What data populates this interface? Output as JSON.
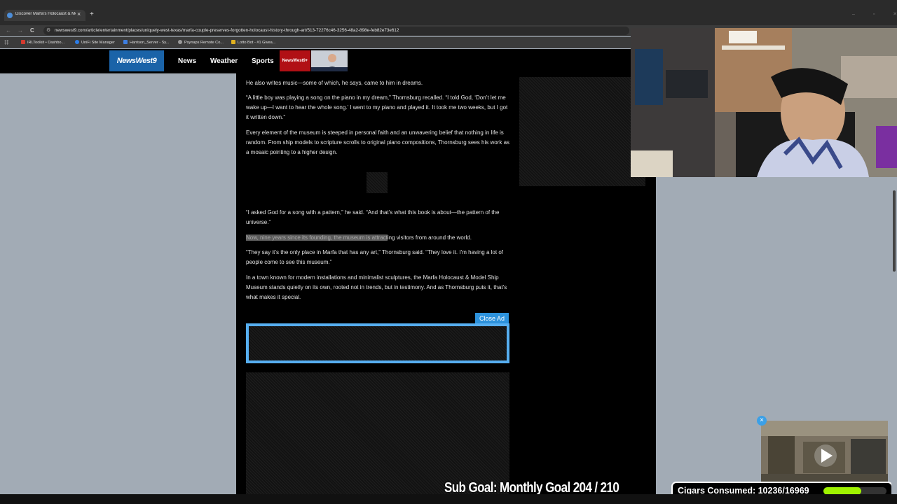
{
  "browser": {
    "tab_title": "Discover Marfa's Holocaust & Model Ship Museum",
    "tab_close": "×",
    "new_tab": "+",
    "url": "newswest9.com/article/entertainment/places/uniquely-west-texas/marfa-couple-preserves-forgotten-holocaust-history-through-art/513-72276c46-3256-48a2-898e-feb82e73e612",
    "window_controls": "– ▫ ✕",
    "nav_back": "←",
    "nav_forward": "→",
    "nav_reload": "C",
    "bookmarks": [
      {
        "label": "IRLToolkit • Dashbo...",
        "color": "#d43a2f"
      },
      {
        "label": "UniFi Site Manager",
        "color": "#2b7de9"
      },
      {
        "label": "Harrison_Server - Sy...",
        "color": "#3d7ee0"
      },
      {
        "label": "Psynaps Remote Co...",
        "color": "#9a9a9a"
      },
      {
        "label": "Lotto Bot - #1 Givea...",
        "color": "#e0b020"
      }
    ]
  },
  "site": {
    "logo": "NewsWest9",
    "nav": [
      "News",
      "Weather",
      "Sports"
    ],
    "plus_badge": "NewsWest9+"
  },
  "article": {
    "paragraphs": [
      "He also writes music—some of which, he says, came to him in dreams.",
      "“A little boy was playing a song on the piano in my dream,” Thornsburg recalled. “I told God, ‘Don’t let me wake up—I want to hear the whole song.’ I went to my piano and played it. It took me two weeks, but I got it written down.”",
      "Every element of the museum is steeped in personal faith and an unwavering belief that nothing in life is random. From ship models to scripture scrolls to original piano compositions, Thornsburg sees his work as a mosaic pointing to a higher design.",
      "“I asked God for a song with a pattern,” he said. “And that’s what this book is about—the pattern of the universe.”",
      "“They say it’s the only place in Marfa that has any art,” Thornsburg said. “They love it. I’m having a lot of people come to see this museum.”",
      "In a town known for modern installations and minimalist sculptures, the Marfa Holocaust & Model Ship Museum stands quietly on its own, rooted not in trends, but in testimony. And as Thornsburg puts it, that’s what makes it special."
    ],
    "highlight_selected": "Now, nine years since its founding, the museum is attract",
    "highlight_rest": "ing visitors from around the world.",
    "close_ad": "Close Ad"
  },
  "overlay": {
    "subgoal": "Sub Goal: Monthly Goal  204 / 210",
    "cigars": "Cigars Consumed: 10236/16969",
    "cigars_progress": 0.6032,
    "cigar_bar_color": "#9ff200"
  },
  "mini_player": {
    "close": "×",
    "play": "▶"
  }
}
